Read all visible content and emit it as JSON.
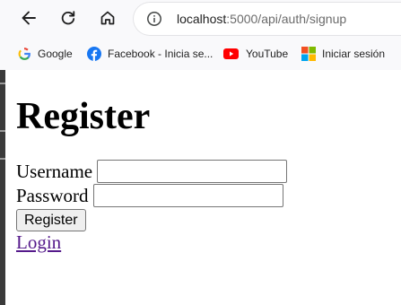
{
  "browser": {
    "url_host": "localhost",
    "url_path": ":5000/api/auth/signup",
    "bookmarks": [
      {
        "label": "Google",
        "icon": "google-icon"
      },
      {
        "label": "Facebook - Inicia se...",
        "icon": "facebook-icon"
      },
      {
        "label": "YouTube",
        "icon": "youtube-icon"
      },
      {
        "label": "Iniciar sesión",
        "icon": "microsoft-icon"
      }
    ]
  },
  "page": {
    "title": "Register",
    "form": {
      "username_label": "Username",
      "username_value": "",
      "password_label": "Password",
      "password_value": "",
      "submit_label": "Register"
    },
    "login_link": "Login"
  },
  "colors": {
    "link_visited": "#551a8b",
    "chrome_bg": "#f9f9fb"
  }
}
